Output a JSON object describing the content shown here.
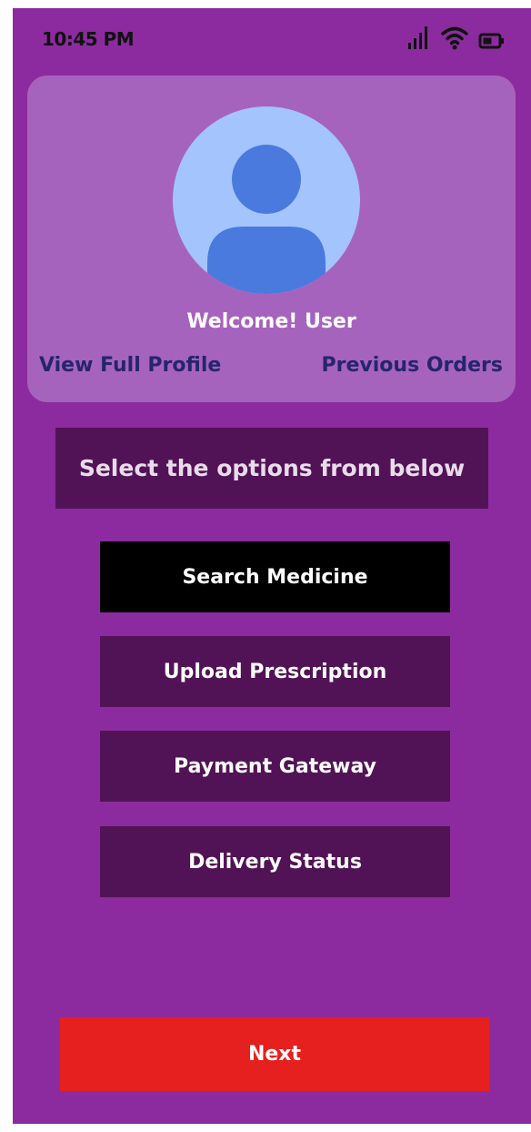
{
  "status_bar": {
    "time": "10:45 PM",
    "icons": [
      "signal-icon",
      "wifi-icon",
      "battery-icon"
    ]
  },
  "profile": {
    "avatar_icon": "user-avatar-icon",
    "welcome_text": "Welcome! User",
    "view_profile_link": "View Full Profile",
    "previous_orders_link": "Previous Orders"
  },
  "instruction_text": "Select the options from below",
  "options": [
    {
      "label": "Search Medicine",
      "selected": true
    },
    {
      "label": "Upload Prescription",
      "selected": false
    },
    {
      "label": "Payment Gateway",
      "selected": false
    },
    {
      "label": "Delivery Status",
      "selected": false
    }
  ],
  "next_label": "Next",
  "colors": {
    "background": "#8c2b9f",
    "card": "#a663bd",
    "option": "#521356",
    "option_selected": "#000000",
    "link": "#27246e",
    "next": "#e5201e",
    "avatar_bg": "#a3c4fc",
    "avatar_fg": "#4a7ade"
  }
}
